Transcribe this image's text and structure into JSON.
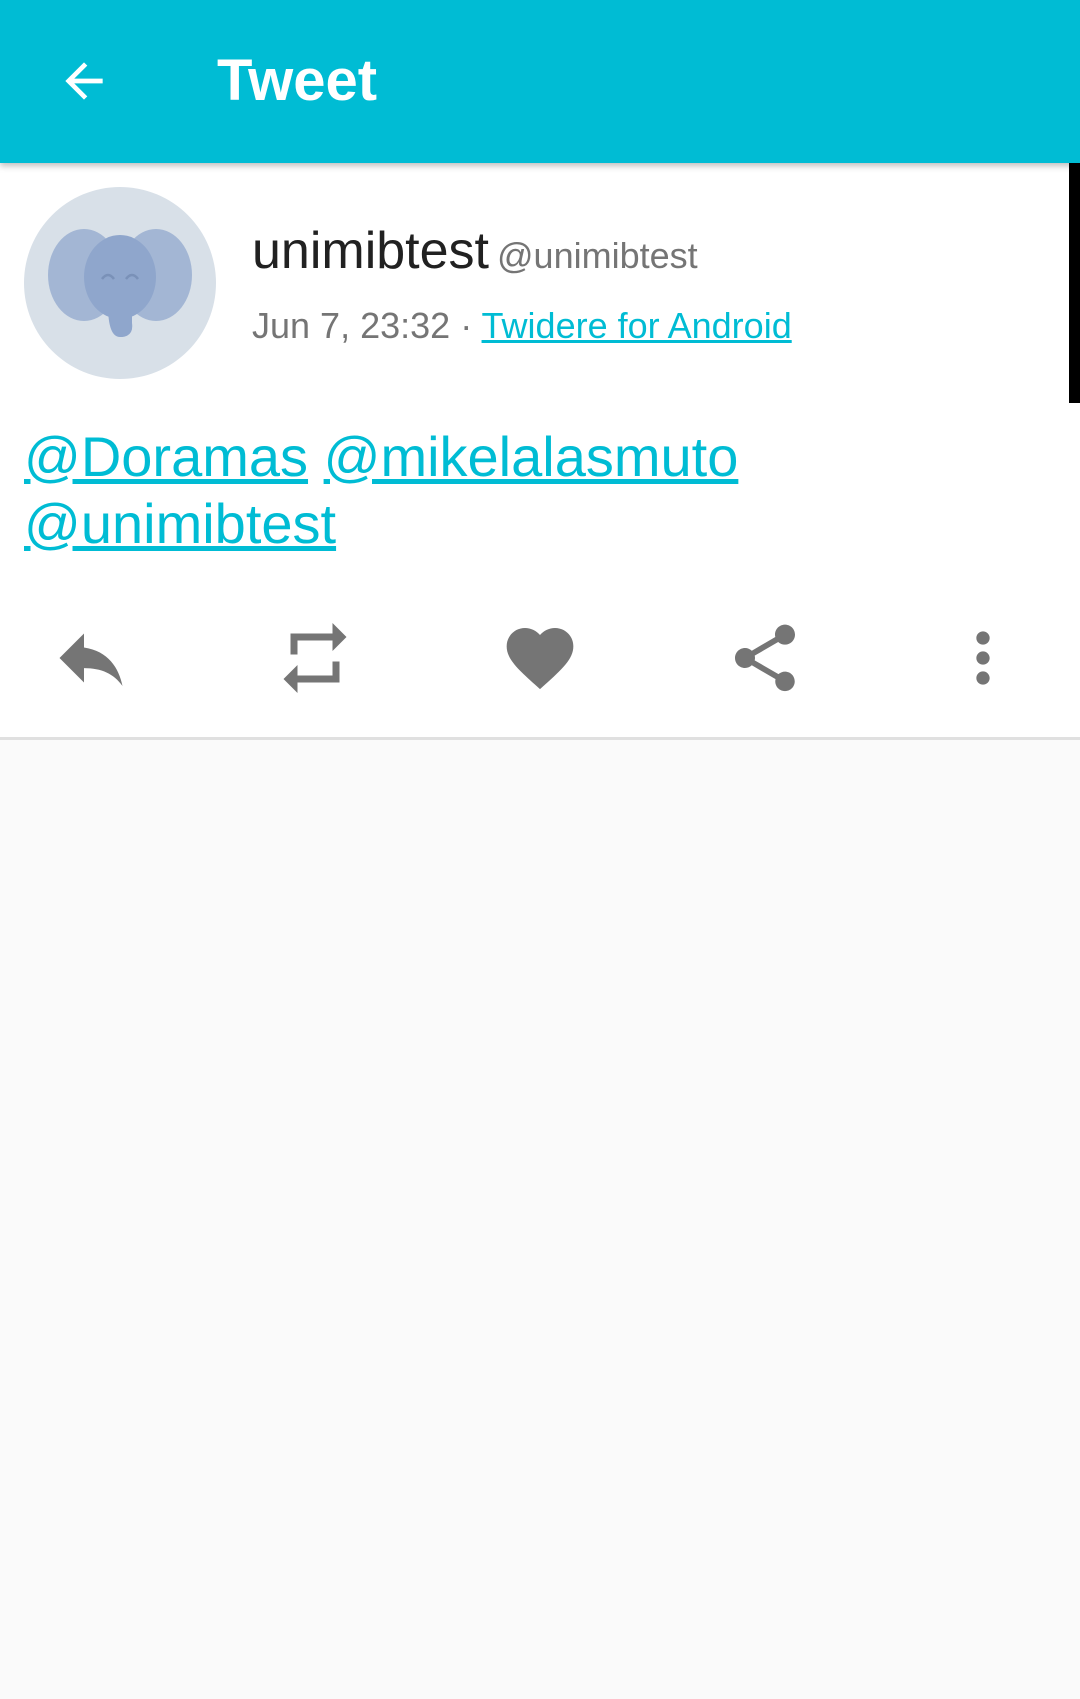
{
  "appbar": {
    "title": "Tweet",
    "back_icon": "arrow-back-icon",
    "background_color": "#00bcd4"
  },
  "tweet": {
    "display_name": "unimibtest",
    "screen_name": "@unimibtest",
    "time": "Jun 7, 23:32",
    "separator": "·",
    "source": "Twidere for Android",
    "mentions": [
      "@Doramas",
      "@mikelalasmuto",
      "@unimibtest"
    ],
    "avatar_icon": "elephant-icon"
  },
  "actions": {
    "reply_icon": "reply-icon",
    "retweet_icon": "retweet-icon",
    "like_icon": "heart-icon",
    "share_icon": "share-icon",
    "more_icon": "more-vert-icon"
  },
  "colors": {
    "accent": "#00bcd4",
    "icon_gray": "#757575",
    "text_primary": "#212121"
  }
}
